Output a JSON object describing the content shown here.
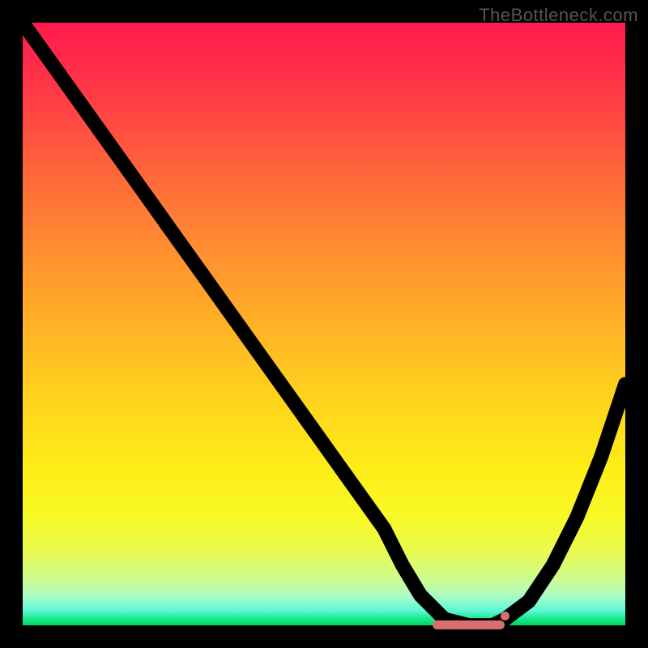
{
  "watermark": "TheBottleneck.com",
  "colors": {
    "frame": "#000000",
    "curve": "#000000",
    "minimum_marker": "#d6706e",
    "gradient_top": "#ff1a4d",
    "gradient_bottom": "#00d562"
  },
  "chart_data": {
    "type": "line",
    "title": "",
    "xlabel": "",
    "ylabel": "",
    "xlim": [
      0,
      100
    ],
    "ylim": [
      0,
      100
    ],
    "legend": false,
    "grid": false,
    "annotations": [],
    "series": [
      {
        "name": "bottleneck-curve",
        "x": [
          0,
          5,
          10,
          15,
          20,
          25,
          30,
          35,
          40,
          45,
          50,
          55,
          60,
          63,
          66,
          70,
          74,
          78,
          80,
          84,
          88,
          92,
          96,
          100
        ],
        "y": [
          100,
          93,
          86,
          79,
          72,
          65,
          58,
          51,
          44,
          37,
          30,
          23,
          16,
          10,
          5,
          1,
          0,
          0,
          1,
          4,
          10,
          18,
          28,
          40
        ]
      }
    ],
    "minimum_region": {
      "x_start": 68,
      "x_end": 80,
      "y": 0
    },
    "minimum_dot": {
      "x": 80,
      "y": 1
    },
    "background_gradient": {
      "direction": "top-to-bottom",
      "stops": [
        {
          "pos": 0,
          "color": "#ff1a4d"
        },
        {
          "pos": 0.5,
          "color": "#ffb126"
        },
        {
          "pos": 0.82,
          "color": "#f8fa26"
        },
        {
          "pos": 1.0,
          "color": "#00d562"
        }
      ]
    }
  }
}
